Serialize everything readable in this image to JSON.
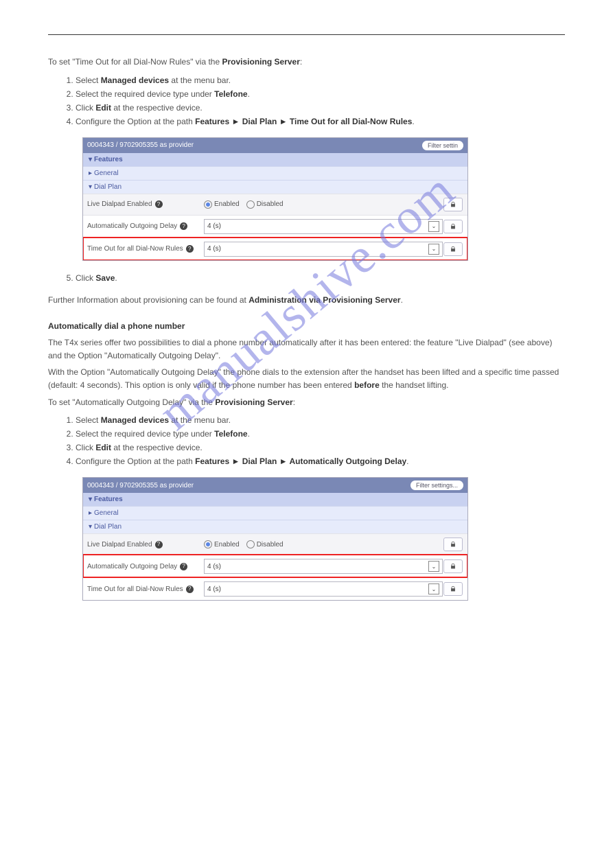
{
  "watermark": "manualshive.com",
  "intro_before": "To set \"Time Out for all Dial-Now Rules\" via the",
  "intro_bold": "Provisioning Server",
  "intro_after": ":",
  "steps1": [
    {
      "pre": "Select ",
      "b": "Managed devices",
      "post": " at the menu bar."
    },
    {
      "pre": "Select the required device type under ",
      "b": "Telefone",
      "post": "."
    },
    {
      "pre": "Click ",
      "b": "Edit",
      "post": " at the respective device."
    },
    {
      "pre": "Configure the Option at the path ",
      "b": "Features ► Dial Plan ► Time Out for all Dial-Now Rules",
      "post": "."
    }
  ],
  "panel1": {
    "titlebar_text": "0004343 / 9702905355 as provider",
    "filter": "Filter settin",
    "features": "Features",
    "general": "General",
    "dialplan": "Dial Plan",
    "rows": {
      "live_label": "Live Dialpad Enabled",
      "enabled": "Enabled",
      "disabled": "Disabled",
      "auto_label": "Automatically Outgoing Delay",
      "auto_value": "4 (s)",
      "timeout_label": "Time Out for all Dial-Now Rules",
      "timeout_value": "4 (s)"
    }
  },
  "save_step_pre": "Click ",
  "save_step_b": "Save",
  "save_step_post": ".",
  "note_before": "Further Information about provisioning can be found at ",
  "note_bold": "Administration via Provisioning Server",
  "note_after": ".",
  "autodial_heading": "Automatically dial a phone number",
  "autodial_p1": "The T4x series offer two possibilities to dial a phone number automatically after it has been entered: the feature \"Live Dialpad\" (see above) and the Option \"Automatically Outgoing Delay\".",
  "autodial_p2_a": "With the Option \"Automatically Outgoing Delay\" the phone dials to the extension after the handset has been lifted and a specific time passed (default: 4 seconds). This option is only valid if the phone number has been entered ",
  "autodial_p2_b": "before",
  "autodial_p2_c": " the handset lifting.",
  "toset2_before": "To set \"Automatically Outgoing Delay\" via the ",
  "toset2_bold": "Provisioning Server",
  "toset2_after": ":",
  "steps2": [
    {
      "pre": "Select ",
      "b": "Managed devices",
      "post": " at the menu bar."
    },
    {
      "pre": "Select the required device type under ",
      "b": "Telefone",
      "post": "."
    },
    {
      "pre": "Click ",
      "b": "Edit",
      "post": " at the respective device."
    },
    {
      "pre": "Configure the Option at the path ",
      "b": "Features ► Dial Plan ► Automatically Outgoing Delay",
      "post": "."
    }
  ],
  "panel2": {
    "titlebar_text": "0004343 / 9702905355 as provider",
    "filter": "Filter settings...",
    "features": "Features",
    "general": "General",
    "dialplan": "Dial Plan",
    "rows": {
      "live_label": "Live Dialpad Enabled",
      "enabled": "Enabled",
      "disabled": "Disabled",
      "auto_label": "Automatically Outgoing Delay",
      "auto_value": "4 (s)",
      "timeout_label": "Time Out for all Dial-Now Rules",
      "timeout_value": "4 (s)"
    }
  }
}
